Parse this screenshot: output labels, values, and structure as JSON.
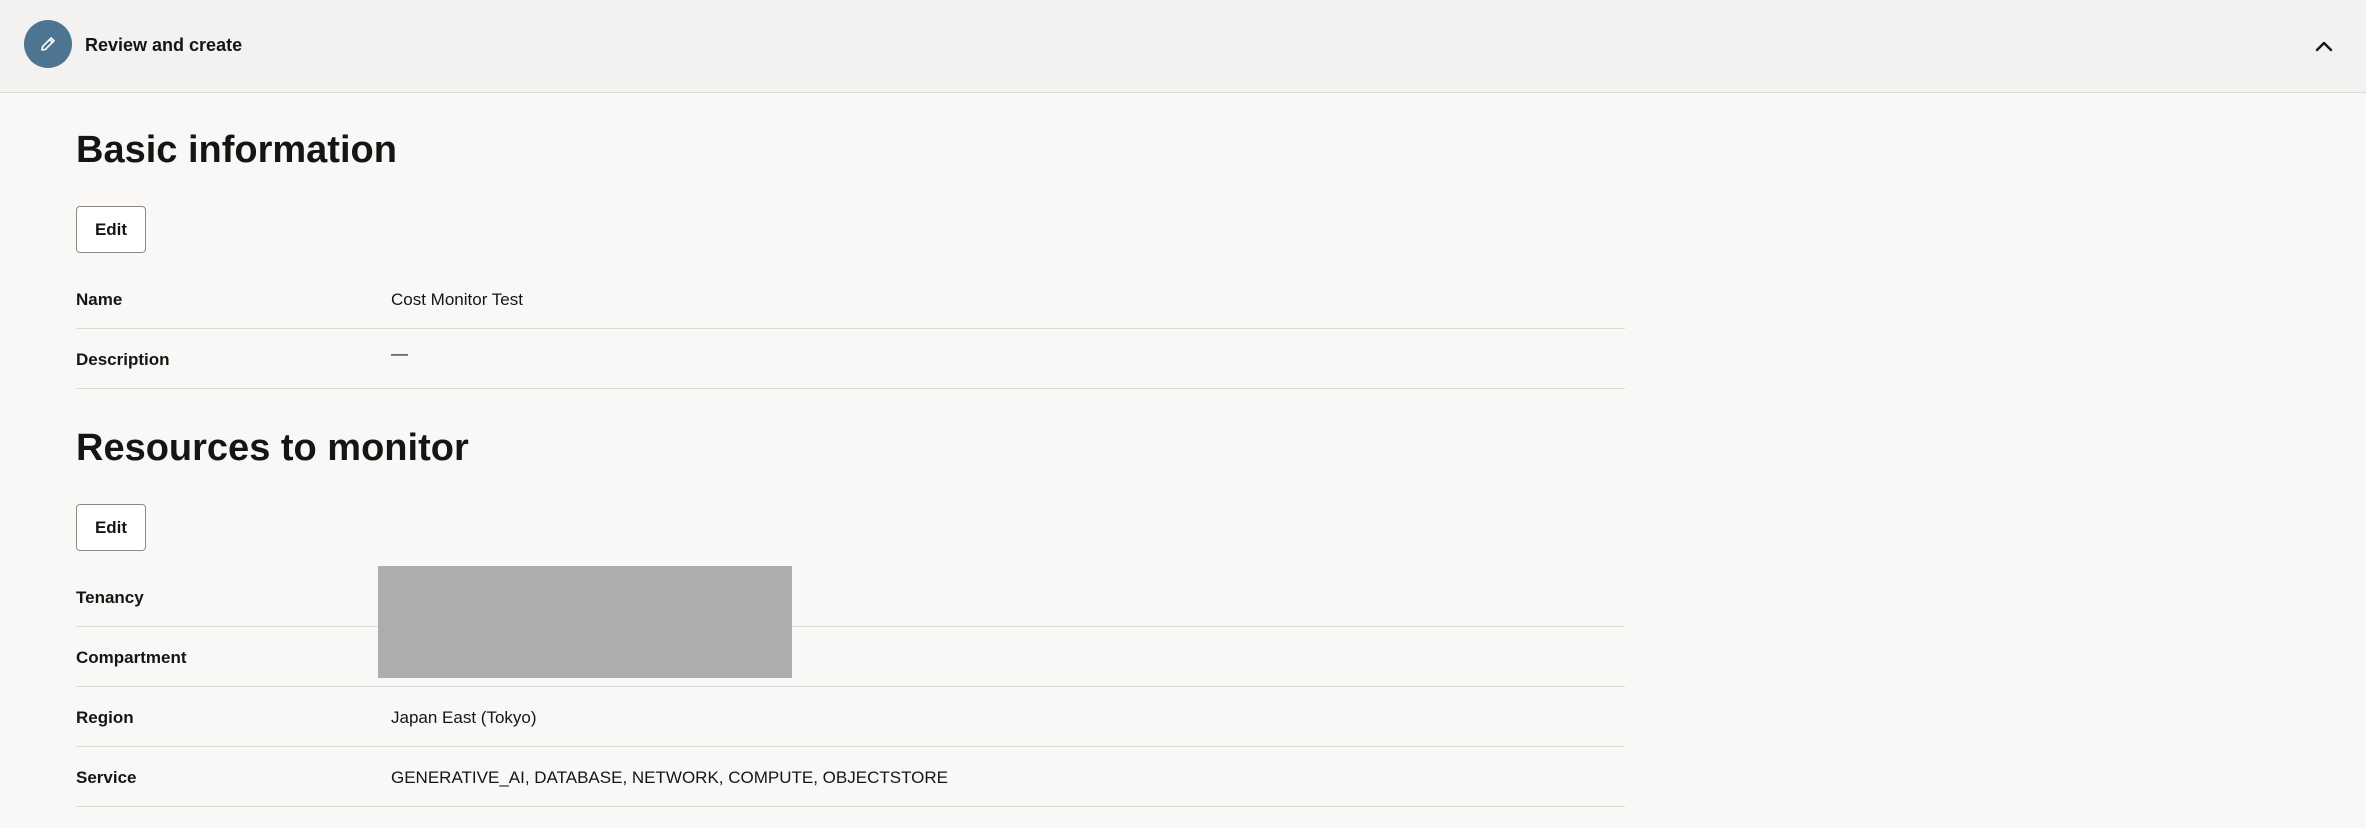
{
  "step": {
    "icon": "pencil-icon",
    "title": "Review and create",
    "collapse_icon": "chevron-up-icon",
    "icon_bg": "#4d7592"
  },
  "basic_information": {
    "heading": "Basic information",
    "edit_label": "Edit",
    "rows": [
      {
        "label": "Name",
        "value": "Cost Monitor Test"
      },
      {
        "label": "Description",
        "value": "—"
      }
    ]
  },
  "resources_to_monitor": {
    "heading": "Resources to monitor",
    "edit_label": "Edit",
    "rows": [
      {
        "label": "Tenancy",
        "value": ""
      },
      {
        "label": "Compartment",
        "value": ""
      },
      {
        "label": "Region",
        "value": "Japan East (Tokyo)"
      },
      {
        "label": "Service",
        "value": "GENERATIVE_AI, DATABASE, NETWORK, COMPUTE, OBJECTSTORE"
      }
    ]
  }
}
